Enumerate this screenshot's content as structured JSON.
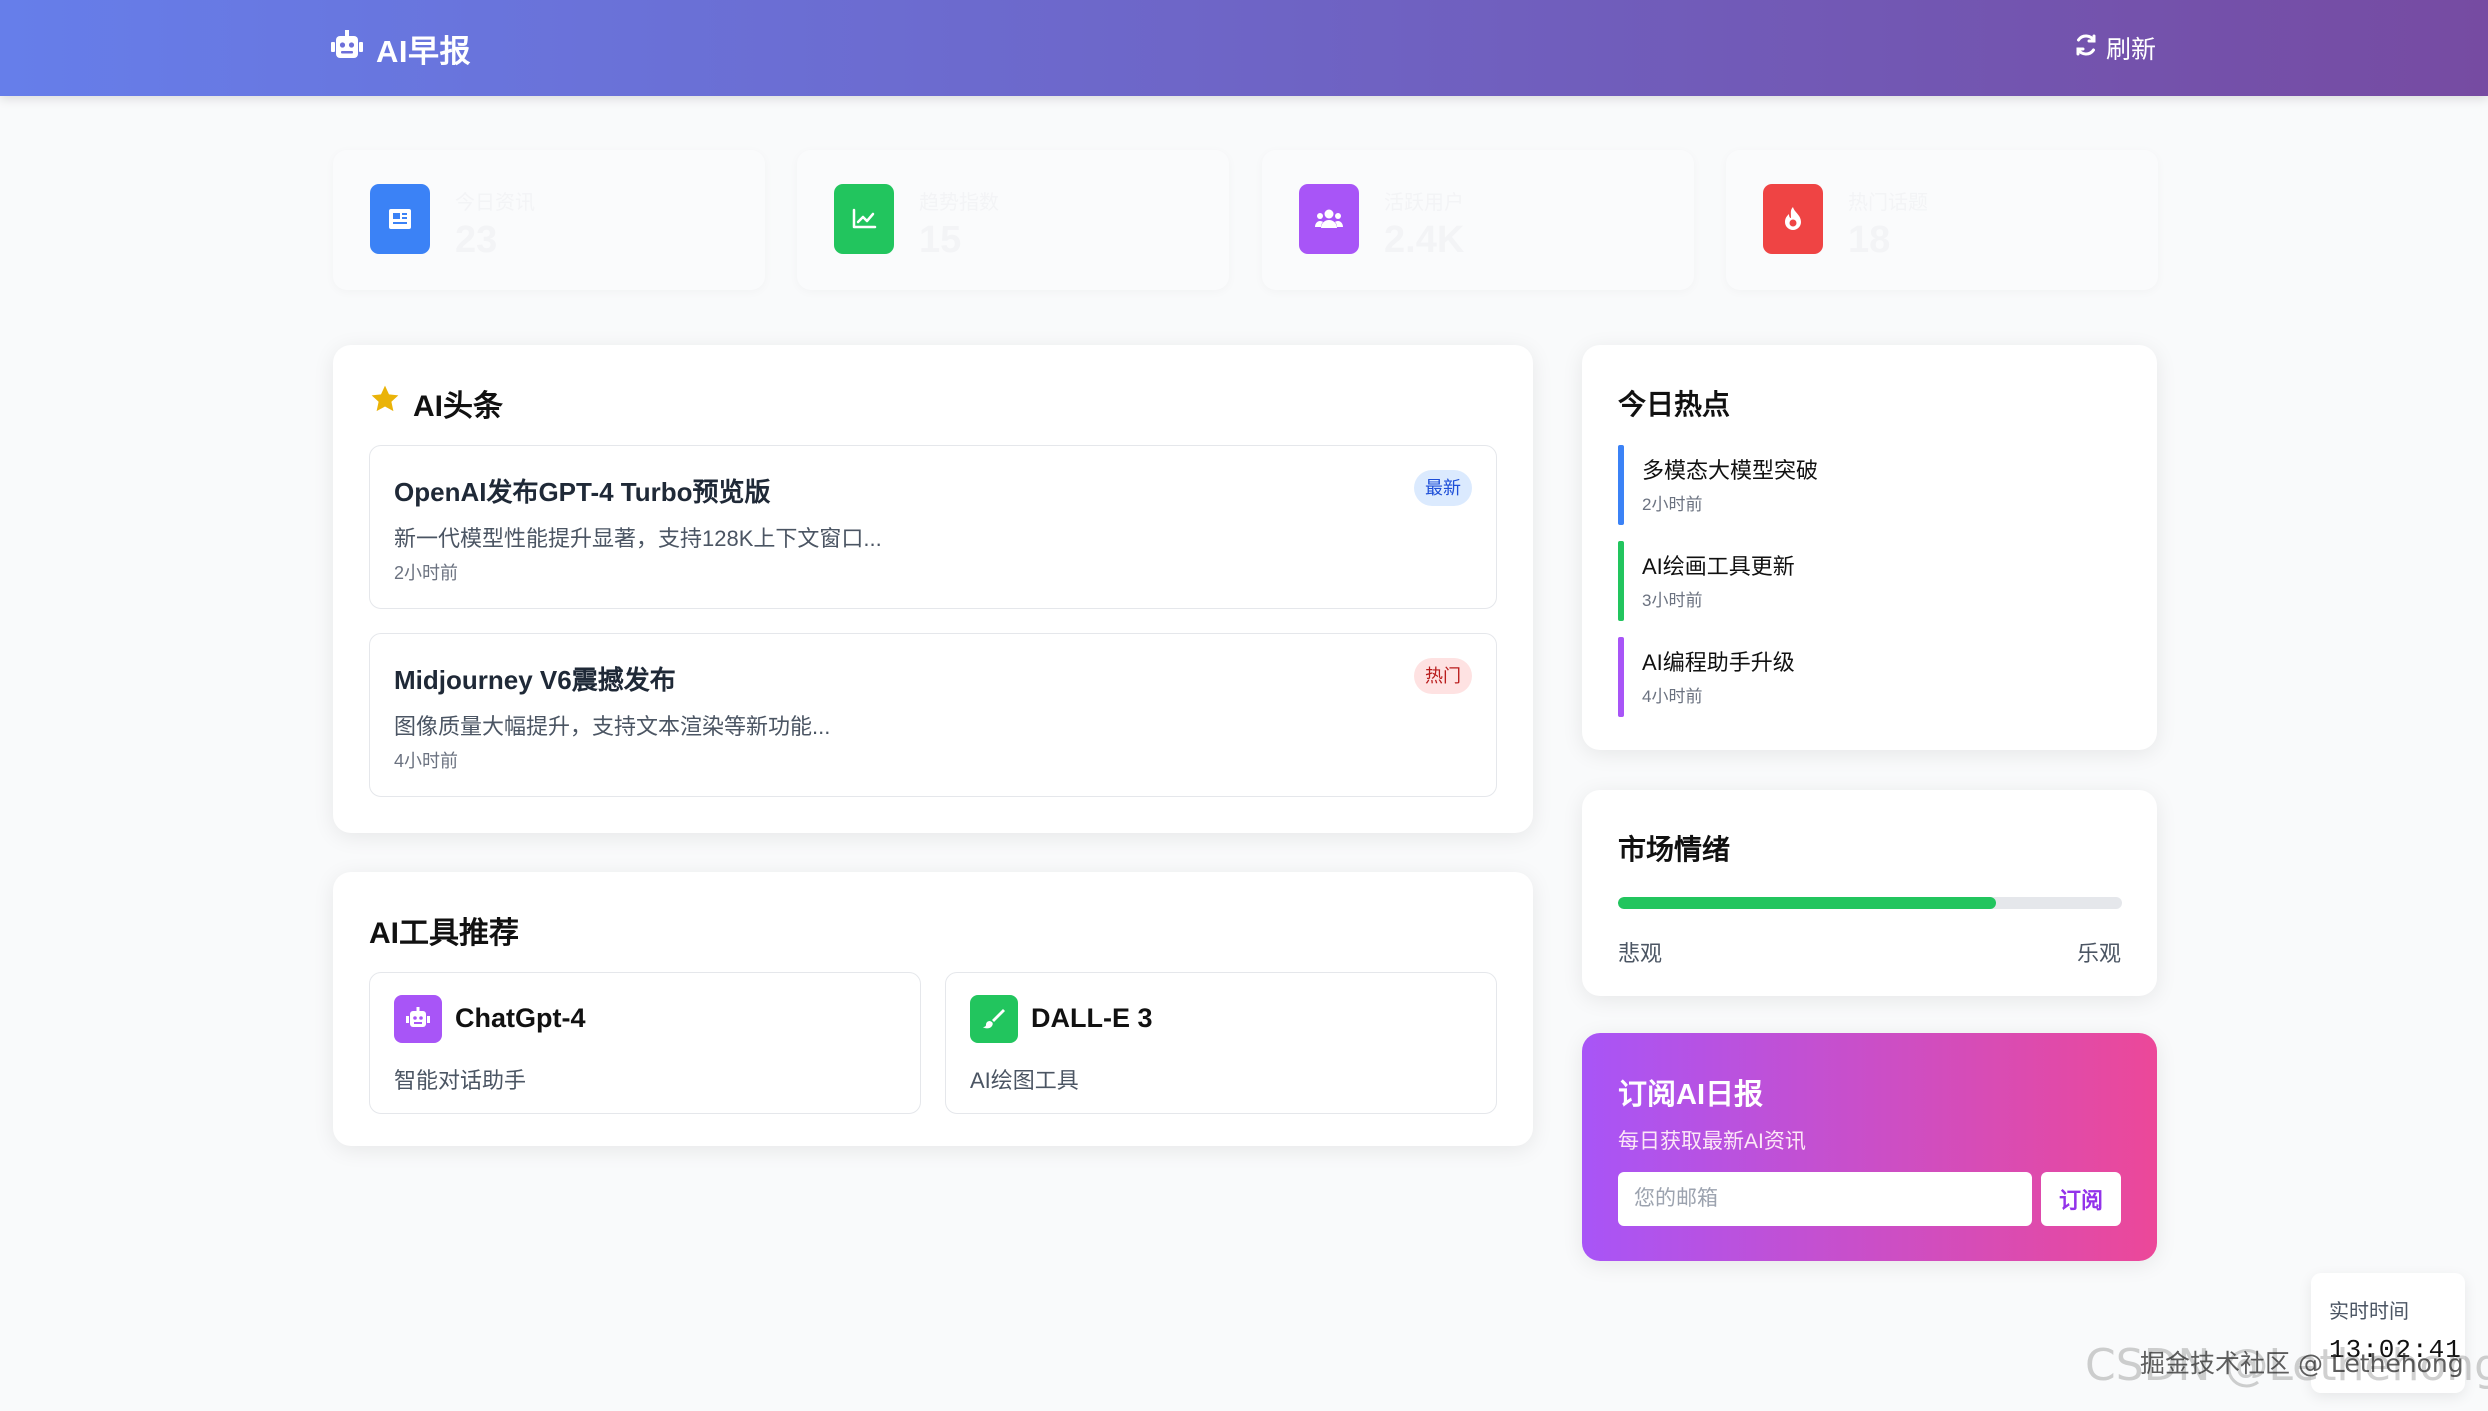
{
  "header": {
    "title": "AI早报",
    "refresh_label": "刷新"
  },
  "stats": [
    {
      "label": "今日资讯",
      "value": "23",
      "icon": "newspaper-icon",
      "color": "#3b82f6"
    },
    {
      "label": "趋势指数",
      "value": "15",
      "icon": "chart-line-icon",
      "color": "#22c55e"
    },
    {
      "label": "活跃用户",
      "value": "2.4K",
      "icon": "users-icon",
      "color": "#a855f7"
    },
    {
      "label": "热门话题",
      "value": "18",
      "icon": "fire-icon",
      "color": "#ef4444"
    }
  ],
  "headlines": {
    "title": "AI头条",
    "items": [
      {
        "title": "OpenAI发布GPT-4 Turbo预览版",
        "desc": "新一代模型性能提升显著，支持128K上下文窗口...",
        "time": "2小时前",
        "badge": "最新"
      },
      {
        "title": "Midjourney V6震撼发布",
        "desc": "图像质量大幅提升，支持文本渲染等新功能...",
        "time": "4小时前",
        "badge": "热门"
      }
    ]
  },
  "tools": {
    "title": "AI工具推荐",
    "items": [
      {
        "name": "ChatGpt-4",
        "desc": "智能对话助手",
        "icon": "robot-icon",
        "color": "#a855f7"
      },
      {
        "name": "DALL-E 3",
        "desc": "AI绘图工具",
        "icon": "paint-brush-icon",
        "color": "#22c55e"
      }
    ]
  },
  "hot": {
    "title": "今日热点",
    "items": [
      {
        "title": "多模态大模型突破",
        "time": "2小时前",
        "color": "#3b82f6"
      },
      {
        "title": "AI绘画工具更新",
        "time": "3小时前",
        "color": "#22c55e"
      },
      {
        "title": "AI编程助手升级",
        "time": "4小时前",
        "color": "#a855f7"
      }
    ]
  },
  "sentiment": {
    "title": "市场情绪",
    "left_label": "悲观",
    "right_label": "乐观",
    "value_percent": 75
  },
  "subscribe": {
    "title": "订阅AI日报",
    "desc": "每日获取最新AI资讯",
    "placeholder": "您的邮箱",
    "button_label": "订阅"
  },
  "clock": {
    "label": "实时时间",
    "time": "13:02:41"
  },
  "watermark": {
    "logo_text": "CSDN @Lethehong",
    "text": "掘金技术社区 @ Lethehong"
  }
}
